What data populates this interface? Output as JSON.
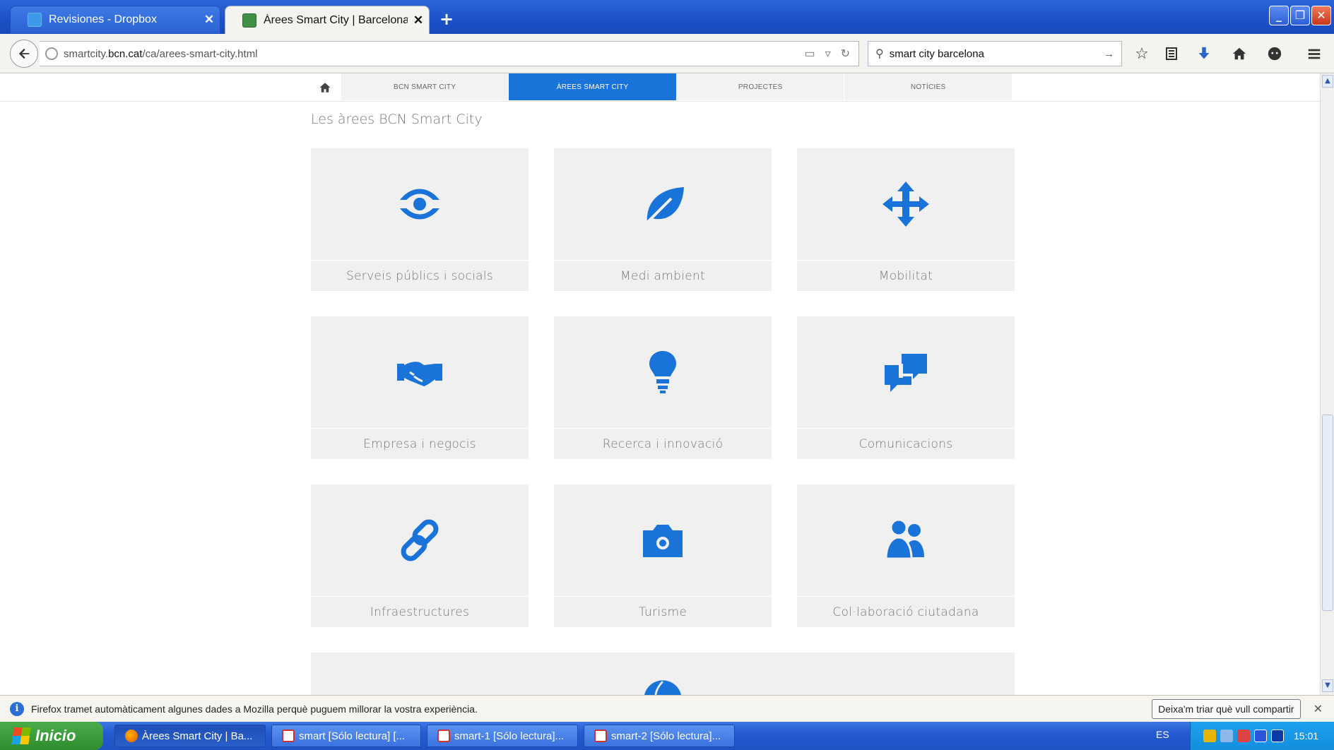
{
  "browser": {
    "tabs": [
      {
        "title": "Revisiones - Dropbox",
        "active": false
      },
      {
        "title": "Àrees Smart City | Barcelona ...",
        "active": true
      }
    ],
    "new_tab": "+",
    "close_glyph": "✕",
    "url_prefix": "smartcity.",
    "url_host": "bcn.cat",
    "url_path": "/ca/arees-smart-city.html",
    "search_value": "smart city barcelona"
  },
  "site": {
    "nav": [
      {
        "label": "BCN SMART CITY",
        "active": false
      },
      {
        "label": "ÀREES SMART CITY",
        "active": true
      },
      {
        "label": "PROJECTES",
        "active": false
      },
      {
        "label": "NOTÍCIES",
        "active": false
      }
    ],
    "section_title": "Les àrees BCN Smart City",
    "areas": [
      {
        "label": "Serveis públics i socials",
        "icon": "eye-icon"
      },
      {
        "label": "Medi ambient",
        "icon": "leaf-icon"
      },
      {
        "label": "Mobilitat",
        "icon": "move-arrows-icon"
      },
      {
        "label": "Empresa i negocis",
        "icon": "handshake-icon"
      },
      {
        "label": "Recerca i innovació",
        "icon": "lightbulb-icon"
      },
      {
        "label": "Comunicacions",
        "icon": "chat-bubbles-icon"
      },
      {
        "label": "Infraestructures",
        "icon": "link-icon"
      },
      {
        "label": "Turisme",
        "icon": "camera-icon"
      },
      {
        "label": "Col·laboració ciutadana",
        "icon": "people-icon"
      }
    ],
    "accent_color": "#1a73d9"
  },
  "notification": {
    "message": "Firefox tramet automàticament algunes dades a Mozilla perquè puguem millorar la vostra experiència.",
    "button": "Deixa'm triar què vull compartir",
    "close": "✕"
  },
  "taskbar": {
    "start_label": "Inicio",
    "tasks": [
      {
        "label": "Àrees Smart City | Ba...",
        "icon": "firefox-icon"
      },
      {
        "label": "smart [Sólo lectura] [...",
        "icon": "document-icon"
      },
      {
        "label": "smart-1 [Sólo lectura]...",
        "icon": "document-icon"
      },
      {
        "label": "smart-2 [Sólo lectura]...",
        "icon": "document-icon"
      }
    ],
    "language": "ES",
    "clock": "15:01"
  }
}
